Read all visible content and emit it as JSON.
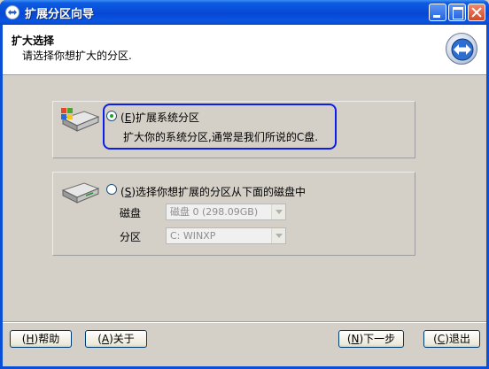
{
  "window": {
    "title": "扩展分区向导"
  },
  "header": {
    "title": "扩大选择",
    "subtitle": "请选择你想扩大的分区."
  },
  "option_system": {
    "shortcut": "E",
    "label": "扩展系统分区",
    "description": "扩大你的系统分区,通常是我们所说的C盘.",
    "checked": true
  },
  "option_other": {
    "shortcut": "S",
    "label": "选择你想扩展的分区从下面的磁盘中",
    "checked": false,
    "disk_label": "磁盘",
    "disk_value": "磁盘 0 (298.09GB)",
    "partition_label": "分区",
    "partition_value": "C: WINXP"
  },
  "buttons": {
    "help": {
      "shortcut": "H",
      "label": "帮助"
    },
    "about": {
      "shortcut": "A",
      "label": "关于"
    },
    "next": {
      "shortcut": "N",
      "label": "下一步"
    },
    "exit": {
      "shortcut": "C",
      "label": "退出"
    }
  },
  "colors": {
    "titlebar": "#0648d4",
    "focus_ring": "#0a1ee8",
    "radio_dot": "#21a121",
    "face": "#d4d0c8"
  }
}
